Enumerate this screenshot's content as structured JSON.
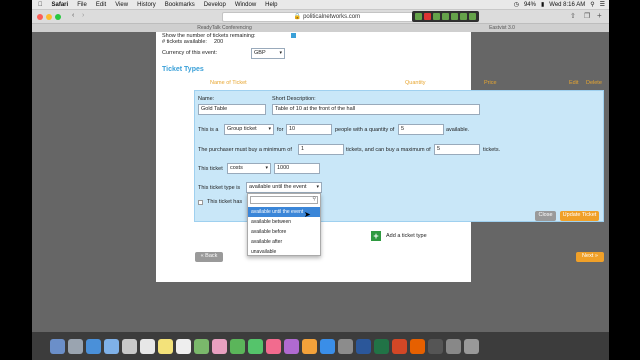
{
  "menubar": {
    "apple": "",
    "items": [
      "Safari",
      "File",
      "Edit",
      "View",
      "History",
      "Bookmarks",
      "Develop",
      "Window",
      "Help"
    ],
    "battery": "94%",
    "clock": "Wed 8:16 AM"
  },
  "browser": {
    "url": "politicalnetworks.com",
    "tabs": [
      "ReadyTalk Conferencing",
      "Eastvist 3.0"
    ]
  },
  "event": {
    "show_remaining_label": "Show the number of tickets remaining:",
    "tickets_available_label": "# tickets available:",
    "tickets_available_value": "200",
    "currency_label": "Currency of this event:",
    "currency_value": "GBP"
  },
  "ticket_types": {
    "section_title": "Ticket Types",
    "columns": {
      "name": "Name of Ticket",
      "quantity": "Quantity",
      "price": "Price",
      "edit": "Edit",
      "delete": "Delete"
    }
  },
  "form": {
    "name_label": "Name:",
    "name_value": "Gold Table",
    "desc_label": "Short Description:",
    "desc_value": "Table of 10 at the front of the hall",
    "this_is_a": "This is a",
    "ticket_kind": "Group ticket",
    "for_label": "for",
    "for_value": "10",
    "people_label": "people with a quantity of",
    "quantity_value": "5",
    "available_label": "available.",
    "min_label": "The purchaser must buy a minimum of",
    "min_value": "1",
    "max_label": "tickets, and can buy a maximum of",
    "max_value": "5",
    "tickets_label": "tickets.",
    "this_ticket_label": "This ticket",
    "costs_value": "costs",
    "price_value": "1000",
    "type_is_label": "This ticket type is",
    "type_is_value": "available until the event",
    "has_label": "This ticket has",
    "close_button": "Close",
    "update_button": "Update Ticket",
    "add_ticket_type": "Add a ticket type"
  },
  "dropdown": {
    "options": [
      "available until the event",
      "available between",
      "available before",
      "available after",
      "unavailable"
    ],
    "selected": "available until the event"
  },
  "nav": {
    "back": "Back",
    "next": "Next"
  },
  "colors": {
    "accent_blue": "#3aa0d8",
    "orange": "#f0a028",
    "panel": "#c9e7f8",
    "green": "#2e9a40",
    "dropdown_highlight": "#3b86d8"
  }
}
